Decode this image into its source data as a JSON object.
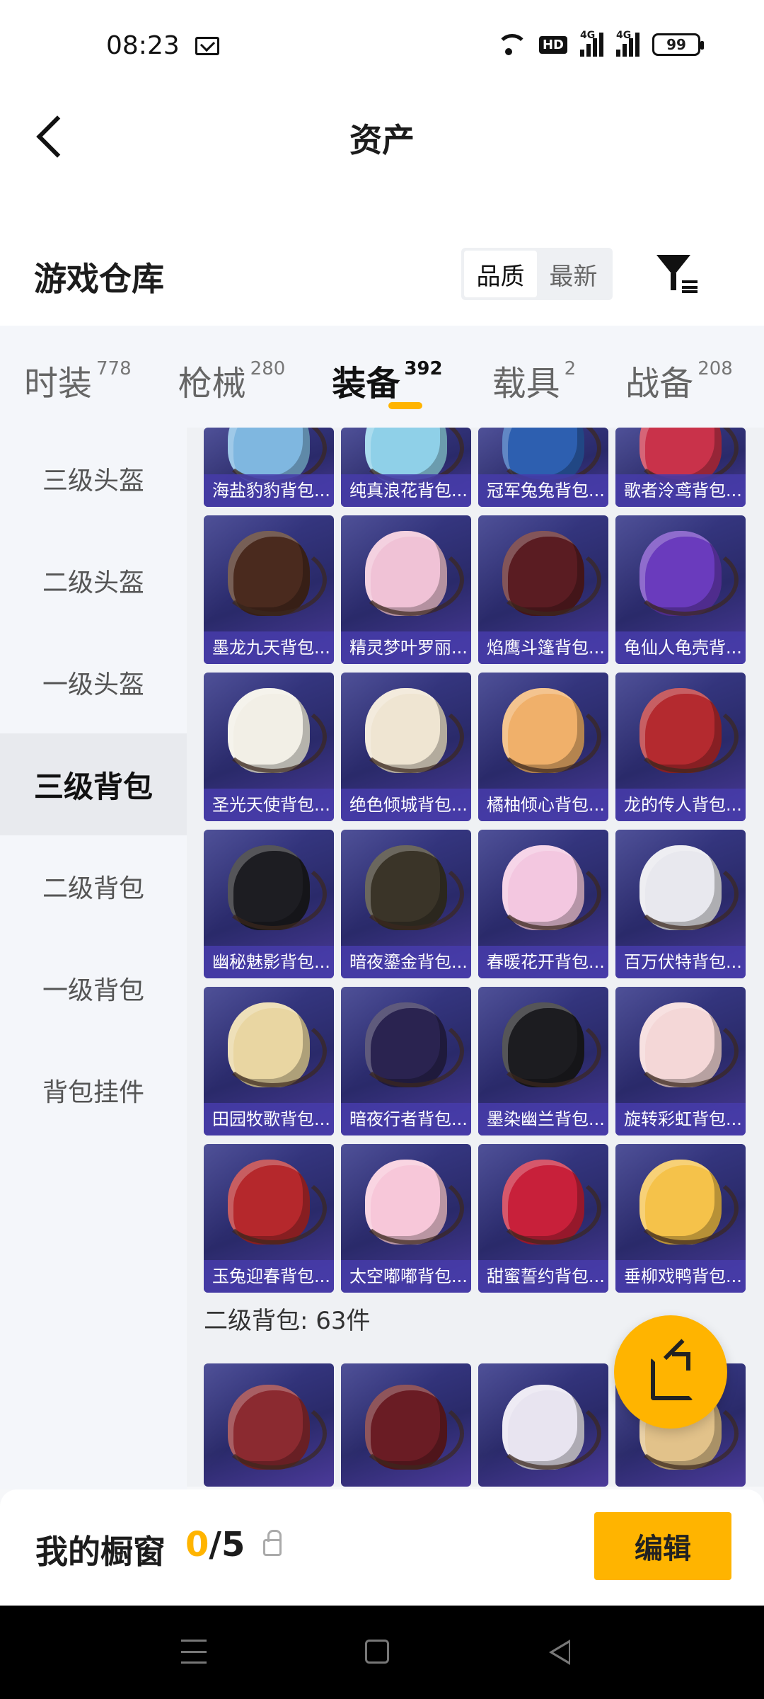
{
  "status_bar": {
    "time": "08:23",
    "hd": "HD",
    "signal1": "4G",
    "signal2": "4G",
    "battery": "99"
  },
  "header": {
    "title": "资产"
  },
  "warehouse": {
    "title": "游戏仓库",
    "sort_options": [
      "品质",
      "最新"
    ]
  },
  "tabs": [
    {
      "label": "时装",
      "count": "778"
    },
    {
      "label": "枪械",
      "count": "280"
    },
    {
      "label": "装备",
      "count": "392"
    },
    {
      "label": "载具",
      "count": "2"
    },
    {
      "label": "战备",
      "count": "208"
    }
  ],
  "sidebar": {
    "items": [
      {
        "label": "三级头盔"
      },
      {
        "label": "二级头盔"
      },
      {
        "label": "一级头盔"
      },
      {
        "label": "三级背包"
      },
      {
        "label": "二级背包"
      },
      {
        "label": "一级背包"
      },
      {
        "label": "背包挂件"
      }
    ]
  },
  "grid": {
    "top_row": [
      "海盐豹豹背包...",
      "纯真浪花背包...",
      "冠军兔兔背包...",
      "歌者泠鸢背包..."
    ],
    "items": [
      "墨龙九天背包...",
      "精灵梦叶罗丽...",
      "焰鹰斗篷背包...",
      "龟仙人龟壳背...",
      "圣光天使背包...",
      "绝色倾城背包...",
      "橘柚倾心背包...",
      "龙的传人背包...",
      "幽秘魅影背包...",
      "暗夜鎏金背包...",
      "春暖花开背包...",
      "百万伏特背包...",
      "田园牧歌背包...",
      "暗夜行者背包...",
      "墨染幽兰背包...",
      "旋转彩虹背包...",
      "玉兔迎春背包...",
      "太空嘟嘟背包...",
      "甜蜜誓约背包...",
      "垂柳戏鸭背包..."
    ],
    "section_label": "二级背包: 63件"
  },
  "showcase": {
    "title": "我的橱窗",
    "current": "0",
    "separator_total": "/5",
    "edit_label": "编辑"
  },
  "colors": {
    "accent": "#ffb400",
    "card_bg": "#2f2f78",
    "card_label": "#4a3ea8"
  },
  "icons": [
    "mail-icon",
    "wifi-icon",
    "back-icon",
    "filter-icon",
    "share-icon",
    "lock-icon"
  ]
}
